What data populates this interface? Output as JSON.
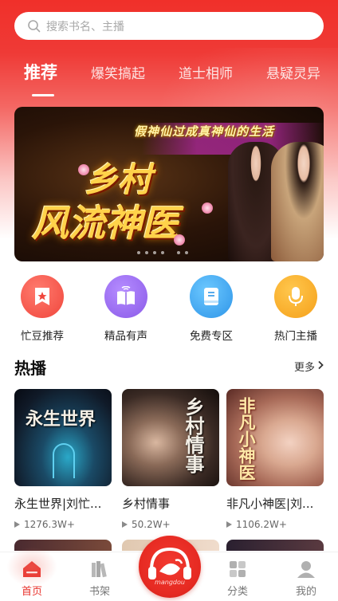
{
  "search": {
    "placeholder": "搜索书名、主播",
    "icon": "search-icon"
  },
  "tabs": [
    {
      "label": "推荐",
      "active": true
    },
    {
      "label": "爆笑搞起",
      "active": false
    },
    {
      "label": "道士相师",
      "active": false
    },
    {
      "label": "悬疑灵异",
      "active": false
    }
  ],
  "banner": {
    "subtitle": "假神仙过成真神仙的生活",
    "title_line1": "乡村",
    "title_line2": "风流神医",
    "page_count": 6,
    "current_page": 1
  },
  "entries": [
    {
      "label": "忙豆推荐",
      "icon": "star-badge-icon",
      "color": "#f24e4e"
    },
    {
      "label": "精品有声",
      "icon": "audio-book-icon",
      "color": "#9b6cf0"
    },
    {
      "label": "免费专区",
      "icon": "book-icon",
      "color": "#3aa6f2"
    },
    {
      "label": "热门主播",
      "icon": "microphone-icon",
      "color": "#f7a623"
    }
  ],
  "hot": {
    "title": "热播",
    "more_label": "更多",
    "items": [
      {
        "title": "永生世界|刘忙...",
        "plays": "1276.3W+",
        "cover_text": "永生世界"
      },
      {
        "title": "乡村情事",
        "plays": "50.2W+",
        "cover_text": "乡村情事"
      },
      {
        "title": "非凡小神医|刘...",
        "plays": "1106.2W+",
        "cover_text": "非凡小神医"
      }
    ]
  },
  "nav": [
    {
      "label": "首页",
      "icon": "home-icon",
      "active": true
    },
    {
      "label": "书架",
      "icon": "bookshelf-icon",
      "active": false
    },
    {
      "label": "",
      "icon": "headphones-logo-icon",
      "center": true
    },
    {
      "label": "分类",
      "icon": "category-icon",
      "active": false
    },
    {
      "label": "我的",
      "icon": "user-icon",
      "active": false
    }
  ],
  "center_button": {
    "brand": "mangdou"
  },
  "colors": {
    "brand_red": "#e8322c",
    "accent": "#f24e4e"
  }
}
